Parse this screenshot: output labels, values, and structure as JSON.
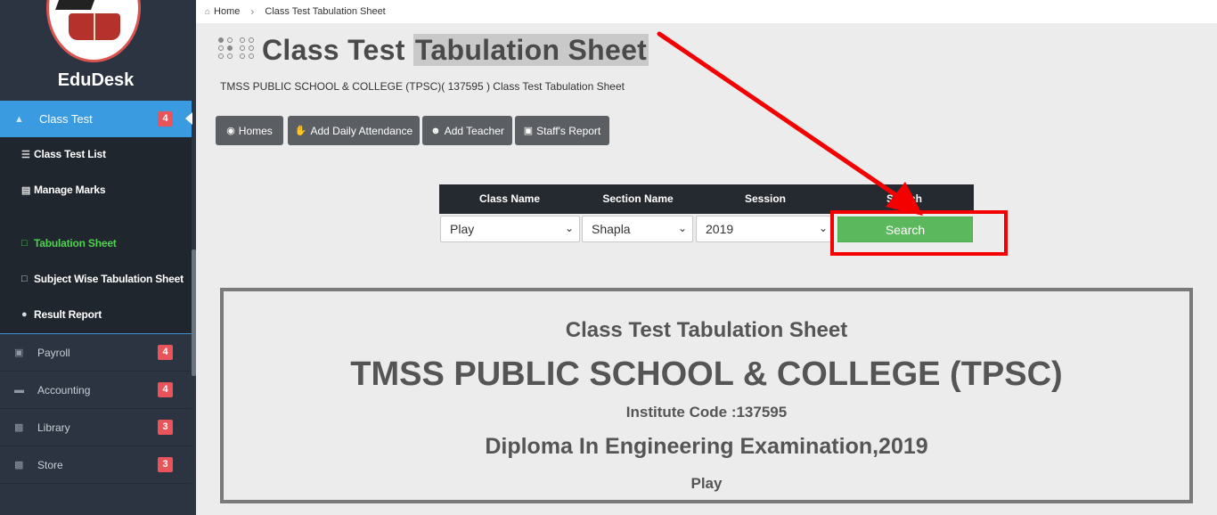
{
  "brand": {
    "name": "EduDesk"
  },
  "breadcrumb": {
    "home": "Home",
    "current": "Class Test Tabulation Sheet"
  },
  "sidebar": {
    "active": {
      "label": "Class Test",
      "badge": "4"
    },
    "submenu": [
      {
        "label": "Class Test List",
        "icon": "list-icon"
      },
      {
        "label": "Manage Marks",
        "icon": "document-icon"
      },
      {
        "label": "Tabulation Sheet",
        "icon": "file-icon",
        "current": true
      },
      {
        "label": "Subject Wise Tabulation Sheet",
        "icon": "file-icon"
      },
      {
        "label": "Result Report",
        "icon": "circle-icon"
      }
    ],
    "items": [
      {
        "label": "Payroll",
        "badge": "4",
        "icon": "money-icon"
      },
      {
        "label": "Accounting",
        "badge": "4",
        "icon": "briefcase-icon"
      },
      {
        "label": "Library",
        "badge": "3",
        "icon": "book-icon"
      },
      {
        "label": "Store",
        "badge": "3",
        "icon": "book-icon"
      }
    ]
  },
  "page": {
    "title_prefix": "Class Test ",
    "title_highlight": "Tabulation Sheet",
    "subtitle": "TMSS PUBLIC SCHOOL & COLLEGE (TPSC)( 137595 ) Class Test Tabulation Sheet"
  },
  "actions": {
    "homes": "Homes",
    "add_daily_attendance": "Add Daily Attendance",
    "add_teacher": "Add Teacher",
    "staffs_report": "Staff's Report"
  },
  "filter": {
    "headers": [
      "Class Name",
      "Section Name",
      "Session",
      "Search"
    ],
    "class_value": "Play",
    "section_value": "Shapla",
    "session_value": "2019",
    "search_label": "Search"
  },
  "report": {
    "heading": "Class Test Tabulation Sheet",
    "school": "TMSS PUBLIC SCHOOL & COLLEGE (TPSC)",
    "institute_code": "Institute Code :137595",
    "exam": "Diploma In Engineering Examination,2019",
    "class": "Play"
  },
  "colors": {
    "sidebar_bg": "#2b3440",
    "active_menu": "#3b9be0",
    "badge": "#e8545a",
    "current_submenu": "#4fd24f",
    "search_button": "#5cb85c",
    "annotation_red": "#f30000"
  }
}
